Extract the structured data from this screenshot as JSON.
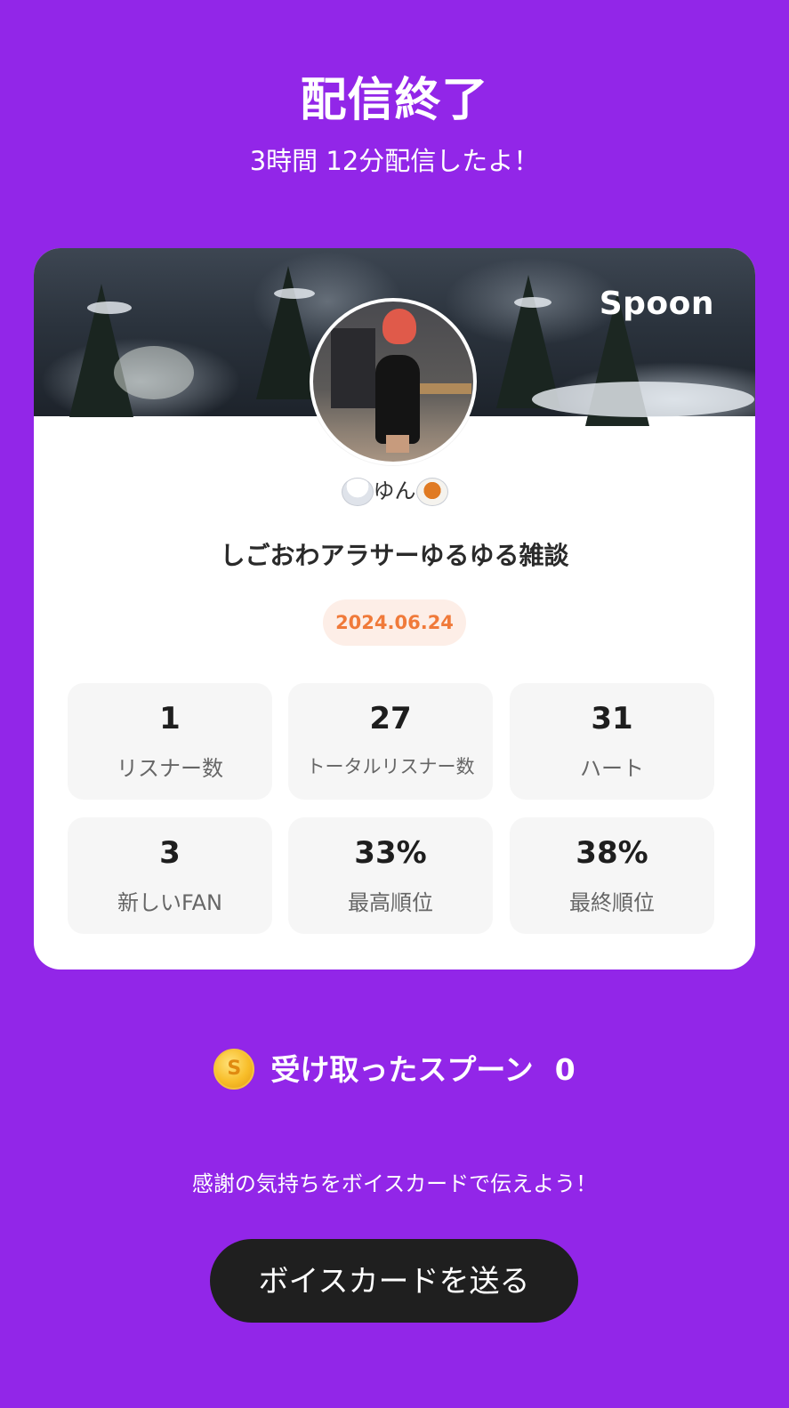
{
  "header": {
    "title": "配信終了",
    "subtitle": "3時間 12分配信したよ！"
  },
  "card": {
    "brand_logo": "Spoon",
    "username": "ゆん",
    "username_emojis": [
      "rice-bowl-icon",
      "curry-rice-icon"
    ],
    "stream_title": "しごおわアラサーゆるゆる雑談",
    "date": "2024.06.24",
    "stats": [
      {
        "value": "1",
        "label": "リスナー数"
      },
      {
        "value": "27",
        "label": "トータルリスナー数"
      },
      {
        "value": "31",
        "label": "ハート"
      },
      {
        "value": "3",
        "label": "新しいFAN"
      },
      {
        "value": "33%",
        "label": "最高順位"
      },
      {
        "value": "38%",
        "label": "最終順位"
      }
    ]
  },
  "spoons": {
    "coin_symbol": "S",
    "label": "受け取ったスプーン",
    "count": "0"
  },
  "thanks_message": "感謝の気持ちをボイスカードで伝えよう！",
  "voice_card_button": "ボイスカードを送る",
  "colors": {
    "background": "#9226e8",
    "card": "#ffffff",
    "date_pill_bg": "#fdeee7",
    "date_text": "#f07a3a",
    "button_bg": "#1f1f1f"
  }
}
